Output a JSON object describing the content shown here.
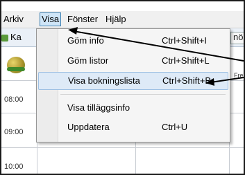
{
  "menubar": {
    "items": [
      "Arkiv",
      "Visa",
      "Fönster",
      "Hjälp"
    ]
  },
  "toolbar": {
    "tab_label": "Ka",
    "right_fragment": "nö"
  },
  "calendar": {
    "times": [
      "08:00",
      "09:00",
      "10:00"
    ],
    "header_fragment": "Fre"
  },
  "menu": {
    "items": [
      {
        "label": "Göm info",
        "shortcut": "Ctrl+Shift+I"
      },
      {
        "label": "Göm listor",
        "shortcut": "Ctrl+Shift+L"
      },
      {
        "label": "Visa bokningslista",
        "shortcut": "Ctrl+Shift+B"
      },
      {
        "label": "Visa tilläggsinfo",
        "shortcut": ""
      },
      {
        "label": "Uppdatera",
        "shortcut": "Ctrl+U"
      }
    ]
  },
  "colors": {
    "highlight": "#deeaf7",
    "menubar_active": "#cfe5f7",
    "arrow": "#000000"
  }
}
